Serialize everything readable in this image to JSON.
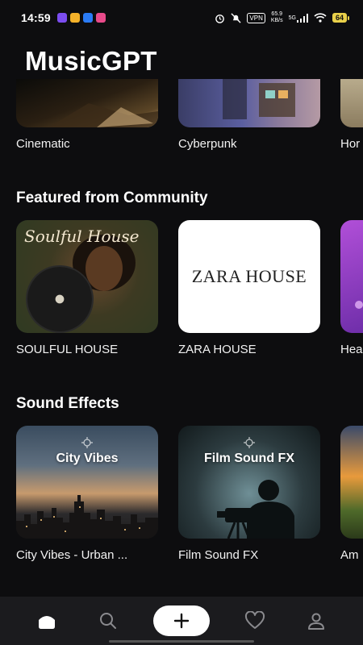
{
  "status": {
    "time": "14:59",
    "vpn": "VPN",
    "speed_value": "65.9",
    "speed_unit": "KB/s",
    "network": "5G",
    "battery": "64"
  },
  "app": {
    "title": "MusicGPT"
  },
  "genres": {
    "items": [
      {
        "label": "Cinematic"
      },
      {
        "label": "Cyberpunk"
      },
      {
        "label": "Hor"
      }
    ]
  },
  "community": {
    "title": "Featured from Community",
    "items": [
      {
        "label": "SOULFUL HOUSE",
        "art_text": "Soulful House"
      },
      {
        "label": "ZARA HOUSE",
        "art_text": "ZARA HOUSE"
      },
      {
        "label": "Hea"
      }
    ]
  },
  "sound_effects": {
    "title": "Sound Effects",
    "items": [
      {
        "label": "City Vibes - Urban ...",
        "art_text": "City Vibes"
      },
      {
        "label": "Film Sound FX",
        "art_text": "Film Sound FX"
      },
      {
        "label": "Am"
      }
    ]
  },
  "nav": {
    "items": [
      {
        "icon": "home-icon",
        "active": true
      },
      {
        "icon": "search-icon",
        "active": false
      },
      {
        "icon": "plus-icon",
        "active": false
      },
      {
        "icon": "heart-icon",
        "active": false
      },
      {
        "icon": "user-icon",
        "active": false
      }
    ]
  },
  "colors": {
    "background": "#0d0d0f",
    "nav_background": "#1b1b1e",
    "battery": "#e9d04a"
  }
}
